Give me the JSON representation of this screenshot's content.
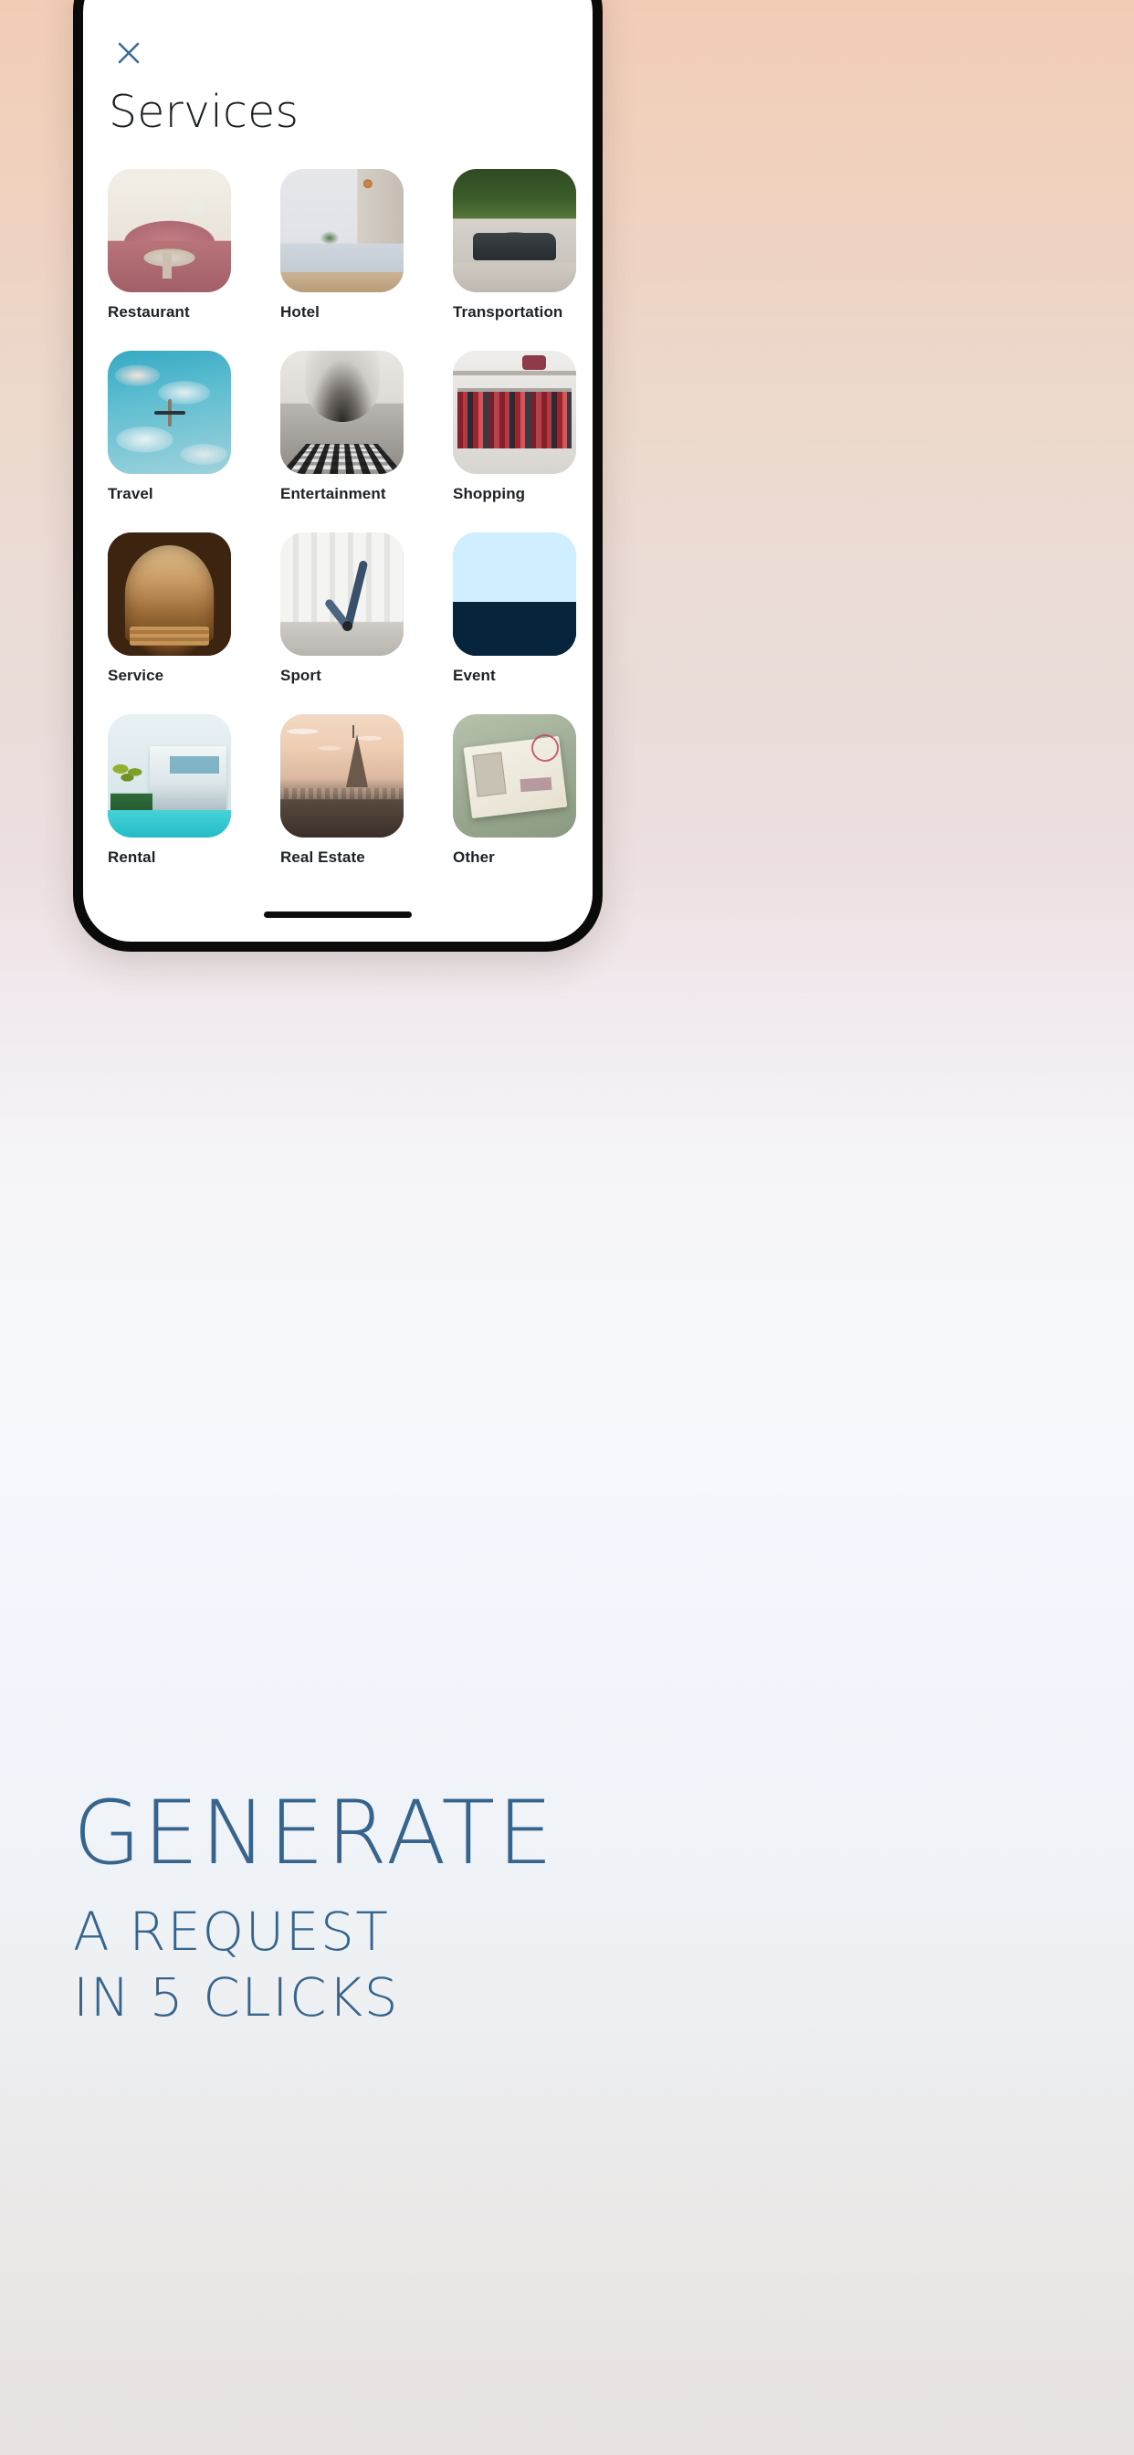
{
  "background": {
    "gradient_top": "#f2cdb6",
    "gradient_mid": "#f7f8fb",
    "gradient_bottom": "#e8e3e0"
  },
  "phone": {
    "frame_color": "#0a0a0a",
    "screen_bg": "#ffffff",
    "home_indicator": "home-indicator"
  },
  "screen": {
    "close_icon": "close-icon",
    "close_icon_color": "#3d6b92",
    "title": "Services",
    "title_color": "#1c2024",
    "label_color": "#1d2226",
    "services": [
      {
        "label": "Restaurant",
        "art": "art-restaurant"
      },
      {
        "label": "Hotel",
        "art": "art-hotel"
      },
      {
        "label": "Transportation",
        "art": "art-transport"
      },
      {
        "label": "Travel",
        "art": "art-travel"
      },
      {
        "label": "Entertainment",
        "art": "art-entertainment"
      },
      {
        "label": "Shopping",
        "art": "art-shopping"
      },
      {
        "label": "Service",
        "art": "art-service"
      },
      {
        "label": "Sport",
        "art": "art-sport"
      },
      {
        "label": "Event",
        "art": "art-event"
      },
      {
        "label": "Rental",
        "art": "art-rental"
      },
      {
        "label": "Real Estate",
        "art": "art-realestate"
      },
      {
        "label": "Other",
        "art": "art-other"
      }
    ]
  },
  "marketing": {
    "headline": "GENERATE",
    "subheadline_line1": "A REQUEST",
    "subheadline_line2": "IN 5 CLICKS",
    "text_color": "#36648c"
  }
}
